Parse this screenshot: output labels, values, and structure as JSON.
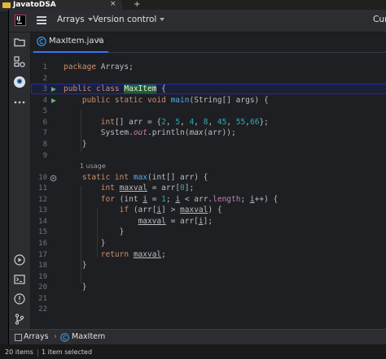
{
  "os_tab": {
    "title": "JavatoDSA",
    "close": "×"
  },
  "os_new_tab": "+",
  "ide": {
    "title_menus": [
      {
        "label": "Arrays"
      },
      {
        "label": "Version control"
      }
    ],
    "right_text": "Cur",
    "tab": {
      "label": "MaxItem.java",
      "close": "×"
    },
    "line_numbers": [
      "1",
      "2",
      "3",
      "4",
      "5",
      "6",
      "7",
      "8",
      "9",
      "10",
      "11",
      "12",
      "13",
      "14",
      "15",
      "16",
      "17",
      "18",
      "19",
      "20",
      "21",
      "22"
    ],
    "usage_hint": "1 usage",
    "code": {
      "l1_kw": "package",
      "l1_rest": " Arrays;",
      "l3_kw": "public class",
      "l3_cls": "MaxItem",
      "l3_rest": " {",
      "l4_kw": "public static void",
      "l4_fn": "main",
      "l4_rest": "(String[] args) {",
      "l6_a": "int",
      "l6_b": "[] arr = {",
      "l6_n1": "2",
      "l6_n2": "5",
      "l6_n3": "4",
      "l6_n4": "8",
      "l6_n5": "45",
      "l6_n6": "55",
      "l6_n7": "66",
      "l6_end": "};",
      "l7_a": "System.",
      "l7_out": "out",
      "l7_b": ".println(",
      "l7_max": "max",
      "l7_c": "(arr));",
      "l8": "}",
      "l10_kw": "static int",
      "l10_fn": "max",
      "l10_rest": "(int[] arr) {",
      "l11_kw": "int",
      "l11_var": "maxval",
      "l11_b": " = arr[",
      "l11_n": "0",
      "l11_c": "];",
      "l12_kw": "for",
      "l12_a": " (int ",
      "l12_i": "i",
      "l12_b": " = ",
      "l12_n": "1",
      "l12_c": "; ",
      "l12_i2": "i",
      "l12_d": " < arr.",
      "l12_len": "length",
      "l12_e": "; ",
      "l12_i3": "i",
      "l12_f": "++) {",
      "l13_kw": "if",
      "l13_a": " (arr[",
      "l13_i": "i",
      "l13_b": "] > ",
      "l13_var": "maxval",
      "l13_c": ") {",
      "l14_var": "maxval",
      "l14_a": " = arr[",
      "l14_i": "i",
      "l14_b": "];",
      "l15": "}",
      "l16": "}",
      "l17_kw": "return",
      "l17_var": "maxval",
      "l17_end": ";",
      "l18": "}",
      "l20": "}"
    },
    "breadcrumb": {
      "package": "Arrays",
      "class": "MaxItem"
    }
  },
  "os_status": {
    "items": "20 items",
    "selected": "1 item selected"
  }
}
